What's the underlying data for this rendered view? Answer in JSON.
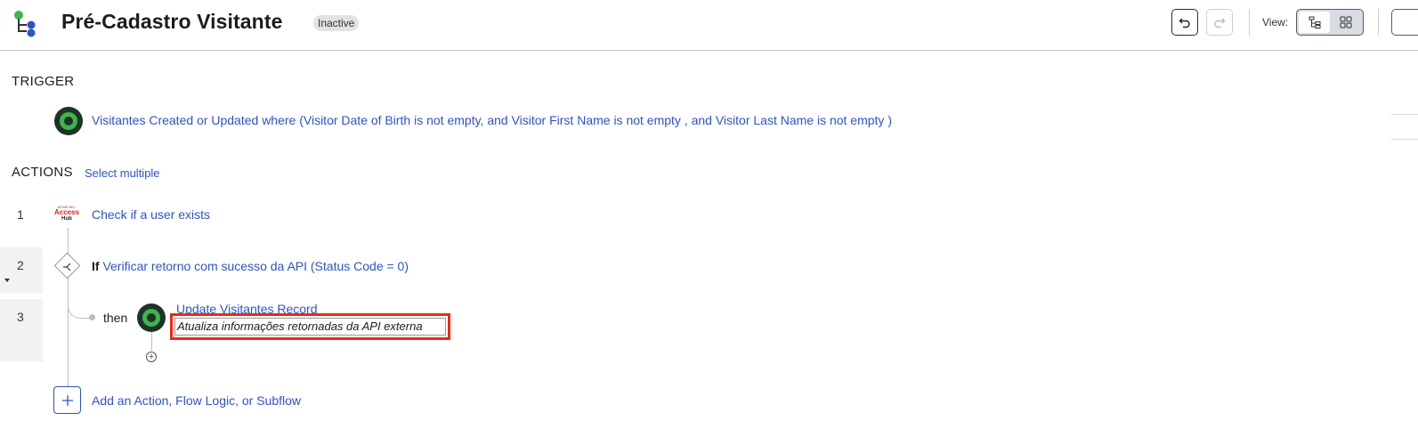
{
  "header": {
    "title": "Pré-Cadastro Visitante",
    "status_badge": "Inactive",
    "view_label": "View:",
    "icons": [
      "app-logo-icon",
      "undo-icon",
      "redo-icon",
      "tree-view-icon",
      "diagram-view-icon"
    ]
  },
  "trigger": {
    "section_title": "TRIGGER",
    "text": "Visitantes Created or Updated where (Visitor Date of Birth is not empty, and Visitor First Name is not empty , and Visitor Last Name is not empty )"
  },
  "actions": {
    "section_title": "ACTIONS",
    "select_multiple": "Select multiple",
    "steps": [
      {
        "num": "1",
        "label": "Check if a user exists",
        "icon": "access-hub-logo"
      },
      {
        "num": "2",
        "keyword": "If",
        "label": "Verificar retorno com sucesso da API (Status Code = 0)",
        "icon": "flow-logic-diamond-icon"
      },
      {
        "num": "3",
        "branch": "then",
        "label": "Update Visitantes Record",
        "description": "Atualiza informações retornadas da API externa",
        "icon": "record-circle-icon"
      }
    ],
    "access_hub_logo": {
      "small": "ACME INC.",
      "top": "Access",
      "bottom": "Hub"
    },
    "add_label": "Add an Action, Flow Logic, or Subflow"
  },
  "colors": {
    "link": "#2f53c7",
    "highlight": "#ee2a11",
    "icon_green": "#3fb34f",
    "icon_dark": "#1e3327"
  }
}
